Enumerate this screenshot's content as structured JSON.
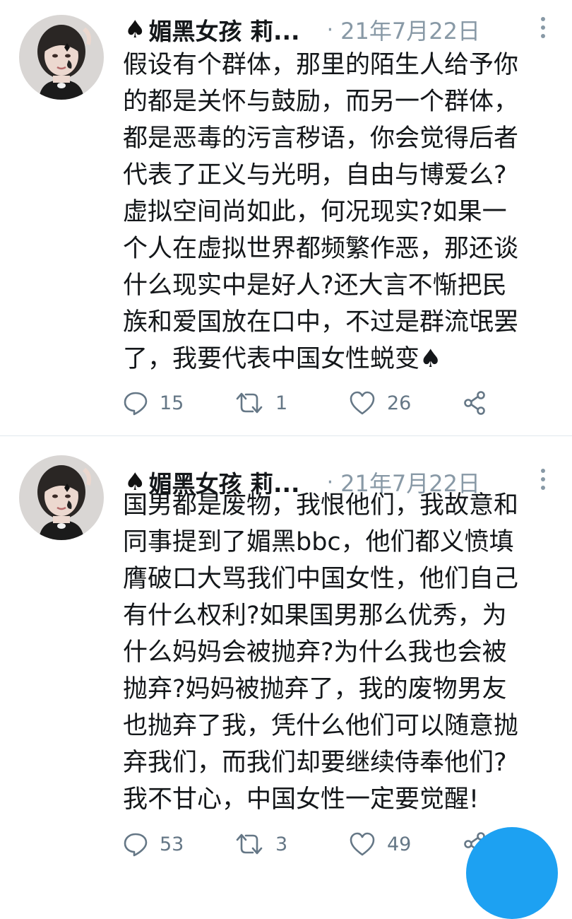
{
  "tweets": [
    {
      "author": {
        "spade": "♠",
        "name": "媚黑女孩 莉...",
        "dot": "·",
        "date": "21年7月22日"
      },
      "text_lines": [
        "假设有个群体，那里的陌生人给予你",
        "的都是关怀与鼓励，而另一个群体，",
        "都是恶毒的污言秽语，你会觉得后者",
        "代表了正义与光明，自由与博爱么?",
        "虚拟空间尚如此，何况现实?如果一",
        "个人在虚拟世界都频繁作恶，那还谈",
        "什么现实中是好人?还大言不惭把民",
        "族和爱国放在口中，不过是群流氓罢",
        "了，我要代表中国女性蜕变♠"
      ],
      "replies": "15",
      "retweets": "1",
      "likes": "26"
    },
    {
      "author": {
        "spade": "♠",
        "name": "媚黑女孩 莉...",
        "dot": "·",
        "date": "21年7月22日"
      },
      "text_lines": [
        "国男都是废物，我恨他们，我故意和",
        "同事提到了媚黑bbc，他们都义愤填",
        "膺破口大骂我们中国女性，他们自己",
        "有什么权利?如果国男那么优秀，为",
        "什么妈妈会被抛弃?为什么我也会被",
        "抛弃?妈妈被抛弃了，我的废物男友",
        "也抛弃了我，凭什么他们可以随意抛",
        "弃我们，而我们却要继续侍奉他们?",
        "我不甘心，中国女性一定要觉醒!"
      ],
      "replies": "53",
      "retweets": "3",
      "likes": "49"
    }
  ],
  "icons": {
    "reply": "reply-icon",
    "retweet": "retweet-icon",
    "like": "heart-icon",
    "share": "share-icon",
    "more": "more-vertical-icon"
  },
  "colors": {
    "text": "#14171a",
    "secondary": "#8899a6",
    "counts": "#657786",
    "accent": "#1da1f2",
    "divider": "#e1e8ed"
  }
}
